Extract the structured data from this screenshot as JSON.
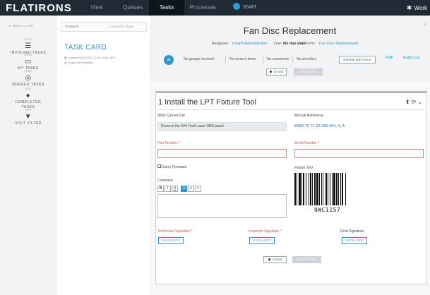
{
  "topbar": {
    "logo": "FLATIRONS",
    "nav": [
      "View",
      "Queues",
      "Tasks",
      "Processes"
    ],
    "start_label": "START",
    "work_label": "Work"
  },
  "leftnav": {
    "new_filter": "NEW FILTER",
    "items": [
      {
        "count": "0000",
        "label": "INVOLVED TASKS",
        "icon": "list-icon"
      },
      {
        "count": "0000",
        "label": "MY TASKS",
        "icon": "inbox-icon"
      },
      {
        "count": "0000",
        "label": "QUEUED TASKS",
        "icon": "target-icon"
      },
      {
        "count": "000",
        "label": "COMPLETED TASKS",
        "icon": "check-icon"
      },
      {
        "count": "000",
        "label": "VISIT FILTER",
        "icon": "filter-icon"
      }
    ]
  },
  "middle": {
    "search_placeholder": "Search",
    "create_task": "CREATE TASK",
    "task_card_title": "TASK CARD",
    "created": "Created 00/20/2022 10:15:15 pm PDT",
    "assignee": "Insight Administrator"
  },
  "header": {
    "title": "Fan Disc Replacement",
    "assignee_label": "Assignee:",
    "assignee": "Insight Administrator",
    "due_label": "Due:",
    "due": "No due date",
    "form_label": "Form:",
    "form": "Fan Disc Replacement",
    "avatar": "IA",
    "stats": [
      "No groups involved",
      "No content items",
      "No comments",
      "No checklist"
    ],
    "show_details": "SHOW DETAILS",
    "pdf": "PDF",
    "audit_log": "Audit Log",
    "save": "SAVE",
    "complete": "COMPLETE"
  },
  "card": {
    "title": "1 Install the LPT Fixture Tool",
    "work_carried_out_label": "Work Carried Out",
    "work_carried_out_value": "Remove the R/H Fwd Lower OBD panel",
    "manual_reference_label": "Manual Reference",
    "manual_reference_value": "EMM-72-71-02-000-801, 4, A",
    "part_number_label": "Part Number *",
    "serial_number_label": "Serial Number *",
    "carry_forward": "Carry Forward",
    "fixture_tool_label": "Fixture Tool",
    "barcode_value": "0WC1157",
    "comment_label": "Comment",
    "technician_signature": "Technician Signature *",
    "inspector_signature": "Inspector Signature *",
    "final_signature": "Final Signature",
    "sign_off": "SIGN-OFF",
    "save": "SAVE",
    "complete": "COMPLETE"
  },
  "colors": {
    "accent": "#2e97c9",
    "topbar": "#1f2a35",
    "required": "#d9534f"
  }
}
